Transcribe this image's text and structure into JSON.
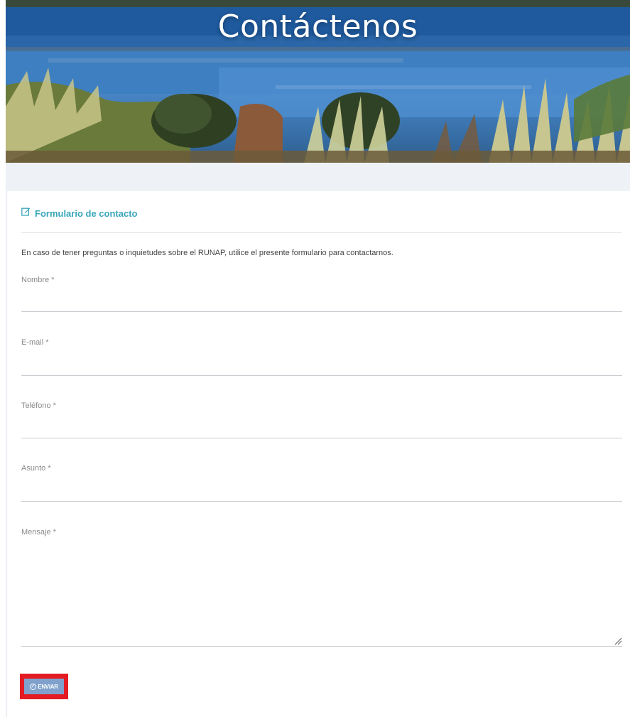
{
  "hero": {
    "title": "Contáctenos"
  },
  "form": {
    "header_icon": "edit-icon",
    "title": "Formulario de contacto",
    "intro": "En caso de tener preguntas o inquietudes sobre el RUNAP, utilice el presente formulario para contactarnos.",
    "fields": [
      {
        "label": "Nombre *",
        "value": ""
      },
      {
        "label": "E-mail *",
        "value": ""
      },
      {
        "label": "Teléfono *",
        "value": ""
      },
      {
        "label": "Asunto *",
        "value": ""
      },
      {
        "label": "Mensaje *",
        "value": ""
      }
    ],
    "submit": {
      "icon": "ban-icon",
      "label": "ENVIAR"
    }
  },
  "colors": {
    "accent_teal": "#3aa6b9",
    "submit_bg": "#7fa1cc",
    "highlight_border": "#e31b23",
    "band_grey": "#eef2f6"
  }
}
